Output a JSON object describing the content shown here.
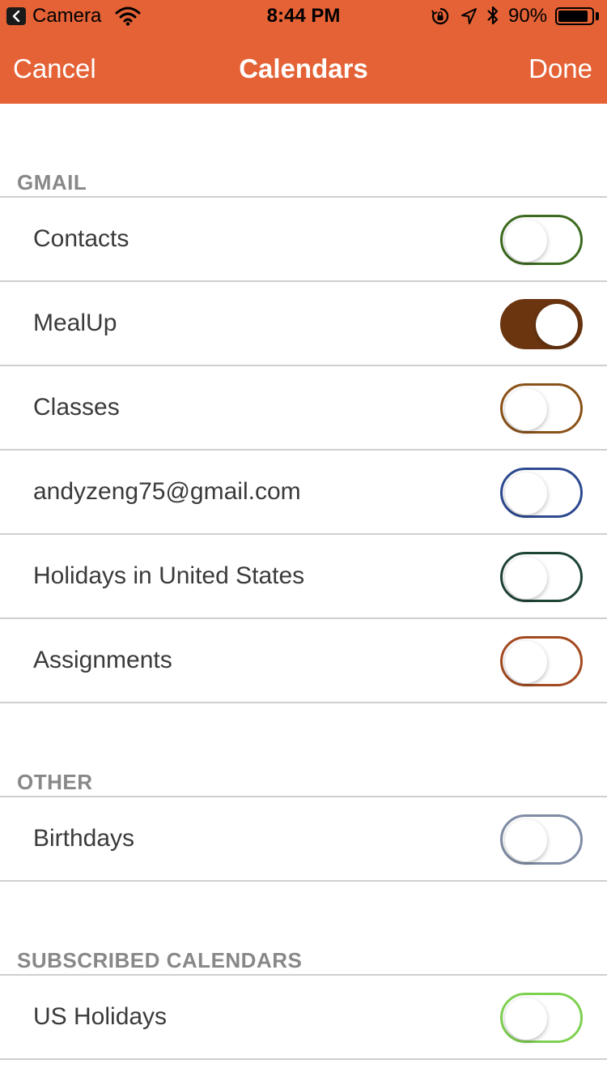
{
  "status_bar": {
    "back_app": "Camera",
    "time": "8:44 PM",
    "battery_percent": "90%",
    "battery_level": 0.9
  },
  "nav": {
    "cancel_label": "Cancel",
    "title": "Calendars",
    "done_label": "Done",
    "background_color": "#e46236"
  },
  "sections": [
    {
      "header": "GMAIL",
      "items": [
        {
          "label": "Contacts",
          "enabled": false,
          "color": "#3d6b1f"
        },
        {
          "label": "MealUp",
          "enabled": true,
          "color": "#6b3510"
        },
        {
          "label": "Classes",
          "enabled": false,
          "color": "#8a5218"
        },
        {
          "label": "andyzeng75@gmail.com",
          "enabled": false,
          "color": "#2d4a90"
        },
        {
          "label": "Holidays in United States",
          "enabled": false,
          "color": "#1e4434"
        },
        {
          "label": "Assignments",
          "enabled": false,
          "color": "#a34a20"
        }
      ]
    },
    {
      "header": "OTHER",
      "items": [
        {
          "label": "Birthdays",
          "enabled": false,
          "color": "#7f8ca4"
        }
      ]
    },
    {
      "header": "SUBSCRIBED CALENDARS",
      "items": [
        {
          "label": "US Holidays",
          "enabled": false,
          "color": "#7fd151"
        }
      ]
    }
  ]
}
